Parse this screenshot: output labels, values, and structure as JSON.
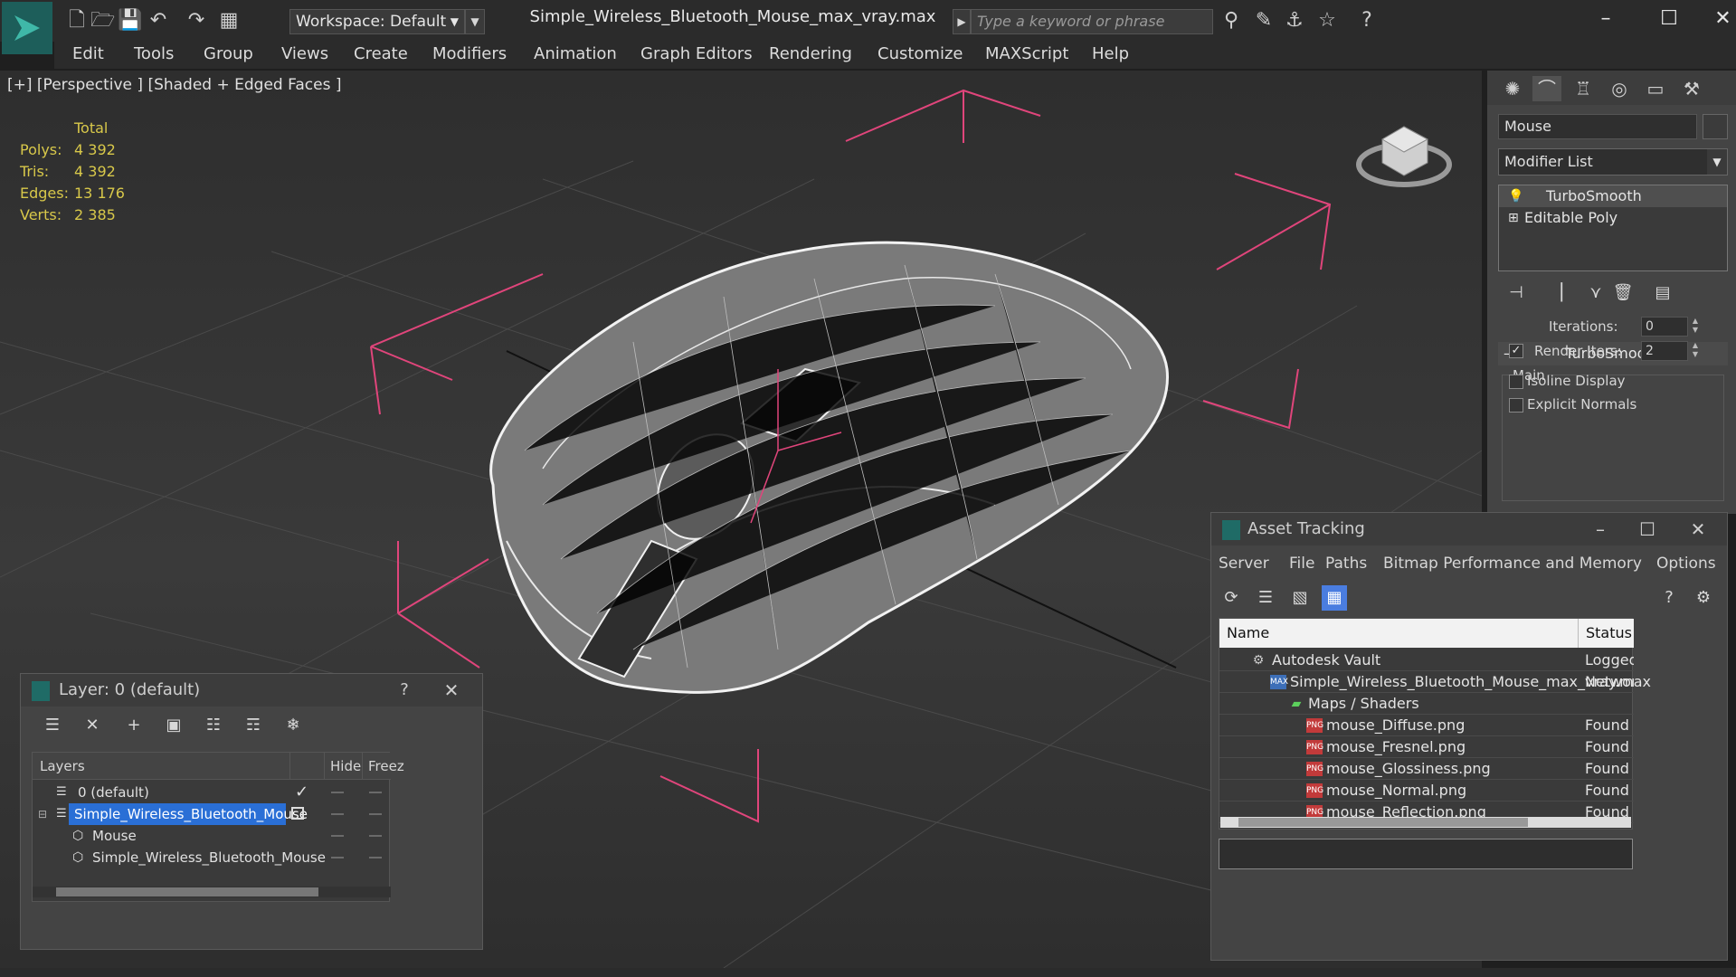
{
  "titlebar": {
    "workspace_label": "Workspace: Default",
    "file_title": "Simple_Wireless_Bluetooth_Mouse_max_vray.max",
    "search_placeholder": "Type a keyword or phrase"
  },
  "menu": [
    "Edit",
    "Tools",
    "Group",
    "Views",
    "Create",
    "Modifiers",
    "Animation",
    "Graph Editors",
    "Rendering",
    "Customize",
    "MAXScript",
    "Help"
  ],
  "viewport": {
    "label": "[+] [Perspective ] [Shaded + Edged Faces ]",
    "stats": {
      "header": "Total",
      "rows": [
        {
          "key": "Polys:",
          "value": "4 392"
        },
        {
          "key": "Tris:",
          "value": "4 392"
        },
        {
          "key": "Edges:",
          "value": "13 176"
        },
        {
          "key": "Verts:",
          "value": "2 385"
        }
      ]
    }
  },
  "command_panel": {
    "object_name": "Mouse",
    "modifier_list": "Modifier List",
    "stack": [
      "TurboSmooth",
      "Editable Poly"
    ],
    "rollout_title": "TurboSmooth",
    "group_title": "Main",
    "iterations_label": "Iterations:",
    "iterations_value": "0",
    "render_iters_label": "Render Iters:",
    "render_iters_value": "2",
    "render_iters_checked": true,
    "isoline_label": "Isoline Display",
    "explicit_normals_label": "Explicit Normals"
  },
  "layer_dialog": {
    "title": "Layer: 0 (default)",
    "help": "?",
    "columns": {
      "layers": "Layers",
      "hide": "Hide",
      "freeze": "Freez"
    },
    "rows": [
      {
        "name": "0 (default)"
      },
      {
        "name": "Simple_Wireless_Bluetooth_Mouse"
      },
      {
        "name": "Mouse"
      },
      {
        "name": "Simple_Wireless_Bluetooth_Mouse"
      }
    ]
  },
  "asset_tracking": {
    "title": "Asset Tracking",
    "menu": [
      "Server",
      "File",
      "Paths",
      "Bitmap Performance and Memory",
      "Options"
    ],
    "columns": {
      "name": "Name",
      "status": "Status"
    },
    "rows": [
      {
        "name": "Autodesk Vault",
        "status": "Logged"
      },
      {
        "name": "Simple_Wireless_Bluetooth_Mouse_max_vray.max",
        "status": "Networ"
      },
      {
        "name": "Maps / Shaders",
        "status": ""
      },
      {
        "name": "mouse_Diffuse.png",
        "status": "Found"
      },
      {
        "name": "mouse_Fresnel.png",
        "status": "Found"
      },
      {
        "name": "mouse_Glossiness.png",
        "status": "Found"
      },
      {
        "name": "mouse_Normal.png",
        "status": "Found"
      },
      {
        "name": "mouse_Reflection.png",
        "status": "Found"
      }
    ],
    "png_badge": "PNG",
    "max_badge": "MAX"
  },
  "colors": {
    "accent": "#2a6fd6",
    "stats_yellow": "#d8c84a",
    "gizmo_pink": "#e0457b",
    "app_teal": "#1f6b66"
  }
}
